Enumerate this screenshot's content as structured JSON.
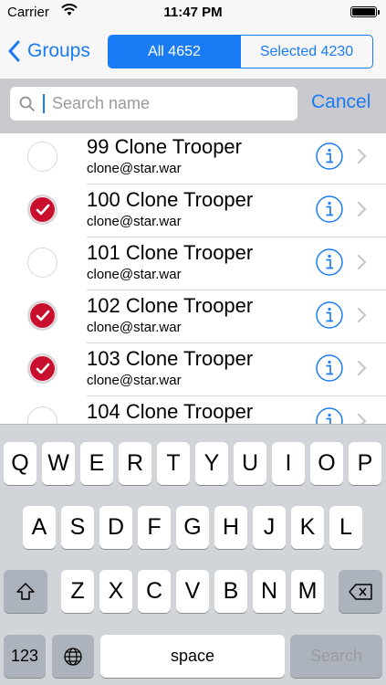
{
  "status_bar": {
    "carrier": "Carrier",
    "time": "11:47 PM"
  },
  "nav": {
    "back_label": "Groups",
    "segments": [
      {
        "label": "All 4652",
        "active": true
      },
      {
        "label": "Selected 4230",
        "active": false
      }
    ]
  },
  "search": {
    "placeholder": "Search name",
    "cancel_label": "Cancel"
  },
  "contacts": [
    {
      "name": "99 Clone Trooper",
      "email": "clone@star.war",
      "selected": false
    },
    {
      "name": "100 Clone Trooper",
      "email": "clone@star.war",
      "selected": true
    },
    {
      "name": "101 Clone Trooper",
      "email": "clone@star.war",
      "selected": false
    },
    {
      "name": "102 Clone Trooper",
      "email": "clone@star.war",
      "selected": true
    },
    {
      "name": "103 Clone Trooper",
      "email": "clone@star.war",
      "selected": true
    },
    {
      "name": "104 Clone Trooper",
      "email": "",
      "selected": false
    }
  ],
  "keyboard": {
    "row1": [
      "Q",
      "W",
      "E",
      "R",
      "T",
      "Y",
      "U",
      "I",
      "O",
      "P"
    ],
    "row2": [
      "A",
      "S",
      "D",
      "F",
      "G",
      "H",
      "J",
      "K",
      "L"
    ],
    "row3": [
      "Z",
      "X",
      "C",
      "V",
      "B",
      "N",
      "M"
    ],
    "numbers_label": "123",
    "space_label": "space",
    "search_label": "Search"
  },
  "colors": {
    "accent": "#1a7cf5",
    "checkmark": "#c8102e",
    "search_bar_bg": "#c9c9ce",
    "keyboard_bg": "#d1d4d9"
  }
}
